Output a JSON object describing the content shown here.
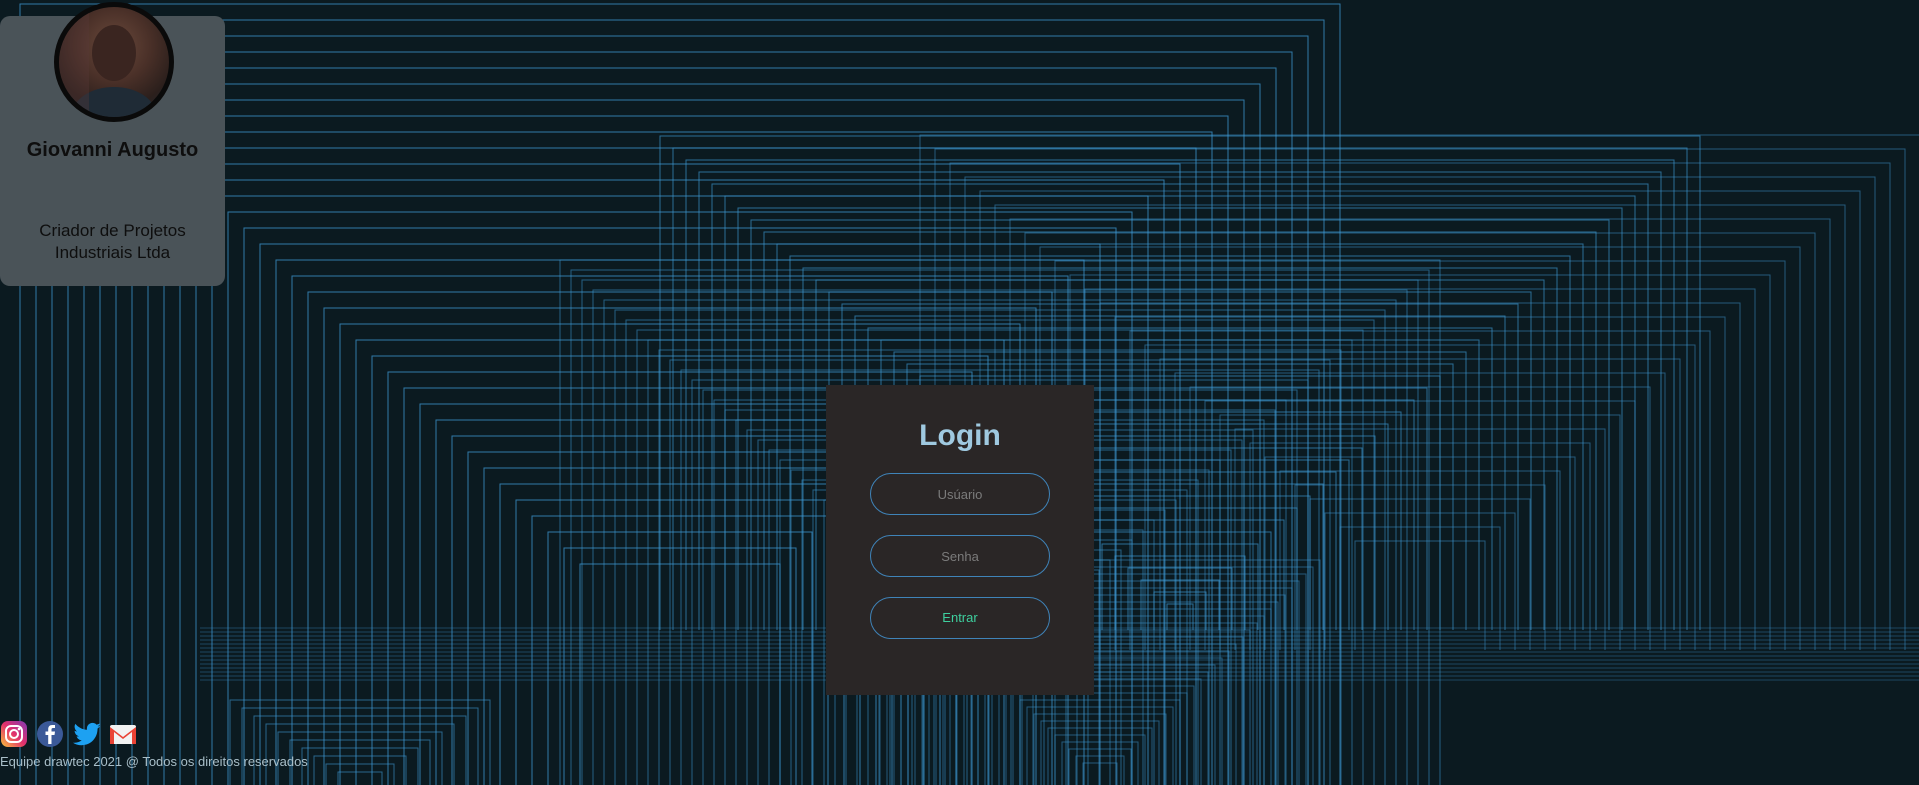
{
  "profile": {
    "name": "Giovanni Augusto",
    "role": "Criador de Projetos Industriais Ltda"
  },
  "login": {
    "title": "Login",
    "user_placeholder": "Usúario",
    "password_placeholder": "Senha",
    "submit_label": "Entrar"
  },
  "social": {
    "icons": [
      "instagram-icon",
      "facebook-icon",
      "twitter-icon",
      "gmail-icon"
    ]
  },
  "footer": {
    "text": "Equipe drawtec 2021 @ Todos os direitos reservados"
  },
  "colors": {
    "background": "#0b1a20",
    "lines": "#3d9ad6",
    "card": "#4a5358",
    "panel": "#2a2626",
    "accent_title": "#9fc9e0",
    "accent_button": "#3ecf9e"
  }
}
